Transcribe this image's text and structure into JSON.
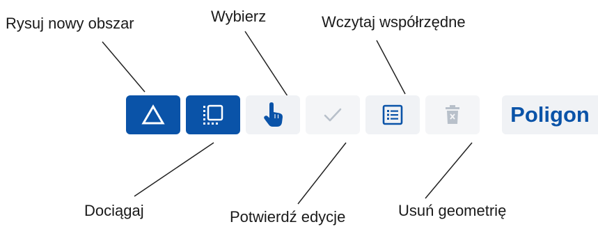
{
  "callouts": {
    "draw_new_area": "Rysuj nowy obszar",
    "select": "Wybierz",
    "load_coordinates": "Wczytaj współrzędne",
    "snap": "Dociągaj",
    "confirm_edit": "Potwierdź edycje",
    "delete_geometry": "Usuń geometrię"
  },
  "toolbar": {
    "buttons": [
      {
        "icon": "triangle-icon",
        "state": "active"
      },
      {
        "icon": "snap-icon",
        "state": "active"
      },
      {
        "icon": "hand-pointer-icon",
        "state": "enabled"
      },
      {
        "icon": "checkmark-icon",
        "state": "disabled"
      },
      {
        "icon": "list-icon",
        "state": "enabled"
      },
      {
        "icon": "trash-icon",
        "state": "disabled"
      }
    ],
    "mode_label": "Poligon"
  },
  "colors": {
    "accent": "#0a53a8",
    "button_light": "#f0f2f5",
    "disabled_icon": "#b8c0ca",
    "text": "#1a1a1a"
  }
}
